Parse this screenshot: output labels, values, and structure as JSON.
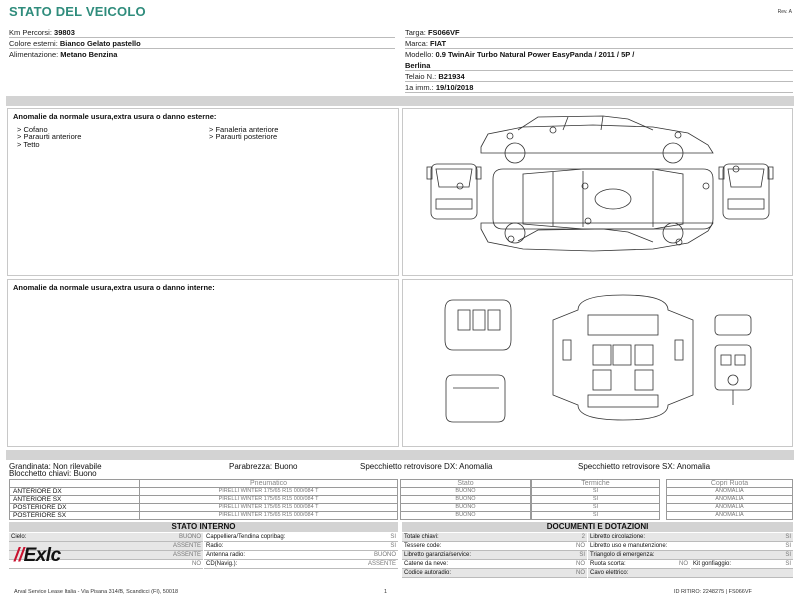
{
  "header": {
    "title": "STATO DEL VEICOLO",
    "rev": "Rev. A"
  },
  "vehicle_left": [
    {
      "label": "Km Percorsi:",
      "value": "39803"
    },
    {
      "label": "Colore esterni:",
      "value": "Bianco Gelato pastello"
    },
    {
      "label": "Alimentazione:",
      "value": "Metano Benzina"
    }
  ],
  "vehicle_right": {
    "targa": {
      "label": "Targa:",
      "value": "FS066VF"
    },
    "marca": {
      "label": "Marca:",
      "value": "FIAT"
    },
    "modello": {
      "label": "Modello:",
      "value_line1": "0.9 TwinAir Turbo Natural Power EasyPanda / 2011 / 5P /",
      "value_line2": "Berlina"
    },
    "telaio": {
      "label": "Telaio N.:",
      "value": "B21934"
    },
    "immatricolazione": {
      "label": "1a imm.:",
      "value": "19/10/2018"
    }
  },
  "external_damage": {
    "title": "Anomalie da normale usura,extra usura o danno esterne:",
    "col1": [
      "> Cofano",
      "> Paraurti anteriore",
      "> Tetto"
    ],
    "col2": [
      "> Fanaleria anteriore",
      "> Paraurti posteriore"
    ]
  },
  "internal_damage": {
    "title": "Anomalie da normale usura,extra usura o danno interne:"
  },
  "status": {
    "grandinata": {
      "label": "Grandinata:",
      "value": "Non rilevabile"
    },
    "bloccaggio": {
      "label": "Blocchetto chiavi:",
      "value": "Buono"
    },
    "parabrezza": {
      "label": "Parabrezza:",
      "value": "Buono"
    },
    "specchio_dx": {
      "label": "Specchietto retrovisore DX:",
      "value": "Anomalia"
    },
    "specchio_sx": {
      "label": "Specchietto retrovisore SX:",
      "value": "Anomalia"
    }
  },
  "tyres": {
    "headers": [
      "Pneumatico",
      "Stato",
      "Termiche",
      "Copri Ruota"
    ],
    "rows": [
      {
        "pos": "ANTERIORE DX",
        "tyre": "PIRELLI WINTER 175/65 R15 000/084 T",
        "stato": "BUONO",
        "termiche": "SI",
        "copri": "ANOMALIA"
      },
      {
        "pos": "ANTERIORE SX",
        "tyre": "PIRELLI WINTER 175/65 R15 000/084 T",
        "stato": "BUONO",
        "termiche": "SI",
        "copri": "ANOMALIA"
      },
      {
        "pos": "POSTERIORE DX",
        "tyre": "PIRELLI WINTER 175/65 R15 000/084 T",
        "stato": "BUONO",
        "termiche": "SI",
        "copri": "ANOMALIA"
      },
      {
        "pos": "POSTERIORE SX",
        "tyre": "PIRELLI WINTER 175/65 R15 000/084 T",
        "stato": "BUONO",
        "termiche": "SI",
        "copri": "ANOMALIA"
      }
    ]
  },
  "stato_interno": {
    "title": "STATO INTERNO",
    "left": [
      {
        "k": "Cielo:",
        "v": "BUONO"
      },
      {
        "k": "",
        "v": "ASSENTE"
      },
      {
        "k": "",
        "v": "ASSENTE"
      },
      {
        "k": "",
        "v": "NO"
      }
    ],
    "right": [
      {
        "k": "Cappelliera/Tendina copribag:",
        "v": "SI"
      },
      {
        "k": "Radio:",
        "v": "SI"
      },
      {
        "k": "Antenna radio:",
        "v": "BUONO"
      },
      {
        "k": "CD(Navig.):",
        "v": "ASSENTE"
      }
    ]
  },
  "documenti": {
    "title": "DOCUMENTI E DOTAZIONI",
    "left": [
      {
        "k": "Totale chiavi:",
        "v": "2"
      },
      {
        "k": "Tessere code:",
        "v": "NO"
      },
      {
        "k": "Libretto garanzia/service:",
        "v": "SI"
      },
      {
        "k": "Catene da neve:",
        "v": "NO"
      },
      {
        "k": "Codice autoradio:",
        "v": "NO"
      }
    ],
    "right": [
      {
        "k": "Libretto circolazione:",
        "v": "SI"
      },
      {
        "k": "Libretto uso e manutenzione:",
        "v": "SI"
      },
      {
        "k": "Triangolo di emergenza:",
        "v": "SI"
      },
      {
        "k": "Ruota scorta:",
        "v": "NO",
        "k2": "Kit gonfiaggio:",
        "v2": "SI"
      },
      {
        "k": "Cavo elettrico:",
        "v": ""
      }
    ]
  },
  "logo": {
    "text": "Exlc",
    "slash": "//"
  },
  "footer": {
    "address": "Arval Service Lease Italia - Via Pisana 314/B, Scandicci (FI), 50018",
    "page": "1",
    "ritiro": "ID RITIRO: 2248275 | FS066VF"
  },
  "colors": {
    "title": "#2f8c7c",
    "damage_marker": "#2334b4",
    "logo_accent": "#c8102e",
    "band": "#d3d3d3"
  }
}
